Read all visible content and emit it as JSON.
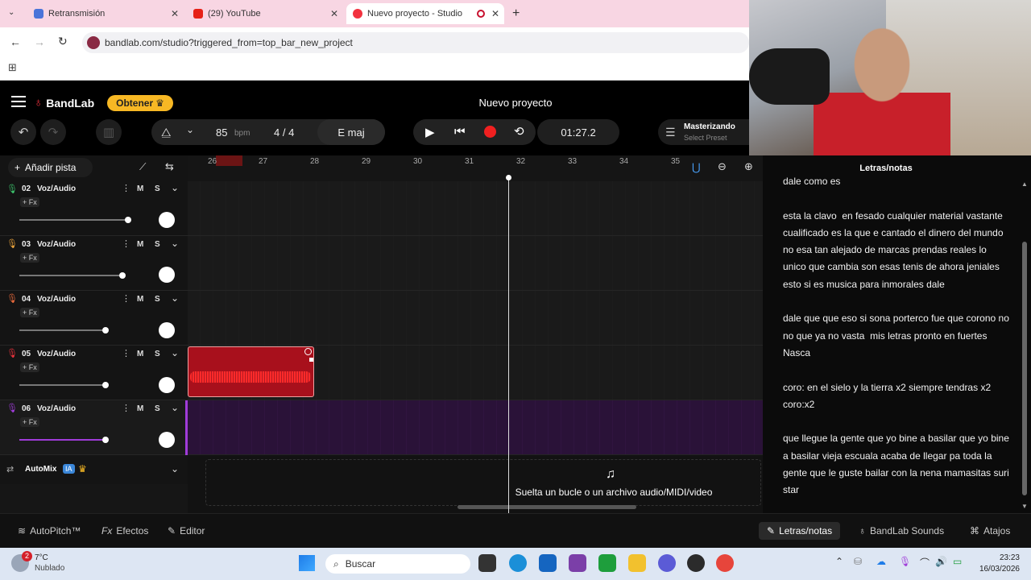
{
  "browser": {
    "tabs": [
      {
        "label": "Retransmisión",
        "color": "#4a74d9"
      },
      {
        "label": "(29) YouTube",
        "color": "#e62117"
      },
      {
        "label": "Nuevo proyecto - Studio",
        "color": "#f2323f"
      }
    ],
    "url": "bandlab.com/studio?triggered_from=top_bar_new_project"
  },
  "header": {
    "logo": "BandLab",
    "get_button": "Obtener",
    "title": "Nuevo proyecto"
  },
  "transport": {
    "bpm_value": "85",
    "bpm_unit": "bpm",
    "time_sig": "4 / 4",
    "key": "E maj",
    "time": "01:27.2",
    "mastering_label": "Masterizando",
    "preset_label": "Select Preset"
  },
  "track_toolbar": {
    "add_track": "Añadir pista"
  },
  "ruler": [
    "26",
    "27",
    "28",
    "29",
    "30",
    "31",
    "32",
    "33",
    "34",
    "35"
  ],
  "tracks": [
    {
      "num": "02",
      "name": "Voz/Audio",
      "fx": "+ Fx",
      "m": "M",
      "s": "S",
      "color": "#3cc06b",
      "vol": 0.89
    },
    {
      "num": "03",
      "name": "Voz/Audio",
      "fx": "+ Fx",
      "m": "M",
      "s": "S",
      "color": "#e8a23c",
      "vol": 0.85
    },
    {
      "num": "04",
      "name": "Voz/Audio",
      "fx": "+ Fx",
      "m": "M",
      "s": "S",
      "color": "#e86a3c",
      "vol": 0.72
    },
    {
      "num": "05",
      "name": "Voz/Audio",
      "fx": "+ Fx",
      "m": "M",
      "s": "S",
      "color": "#e8323c",
      "vol": 0.72
    },
    {
      "num": "06",
      "name": "Voz/Audio",
      "fx": "+ Fx",
      "m": "M",
      "s": "S",
      "color": "#a03cd9",
      "vol": 0.72
    }
  ],
  "automix": {
    "label": "AutoMix",
    "badge": "IA"
  },
  "dropzone": "Suelta un bucle o un archivo audio/MIDI/video",
  "lyrics": {
    "title": "Letras/notas",
    "text": "dale como es\n\nesta la clavo  en fesado cualquier material vastante cualificado es la que e cantado el dinero del mundo no esa tan alejado de marcas prendas reales lo unico que cambia son esas tenis de ahora jeniales esto si es musica para inmorales dale\n\ndale que que eso si sona porterco fue que corono no no que ya no vasta  mis letras pronto en fuertes Nasca\n\ncoro: en el sielo y la tierra x2 siempre tendras x2 coro:x2\n\nque llegue la gente que yo bine a basilar que yo bine a basilar vieja escuala acaba de llegar pa toda la gente que le guste bailar con la nena mamasitas suri star"
  },
  "bottom": {
    "autopitch": "AutoPitch™",
    "effects": "Efectos",
    "editor": "Editor",
    "lyrics": "Letras/notas",
    "sounds": "BandLab Sounds",
    "shortcuts": "Atajos"
  },
  "taskbar": {
    "weather_temp": "7°C",
    "weather_desc": "Nublado",
    "weather_badge": "2",
    "search": "Buscar",
    "time": "23:23",
    "date": "16/03/2026"
  }
}
